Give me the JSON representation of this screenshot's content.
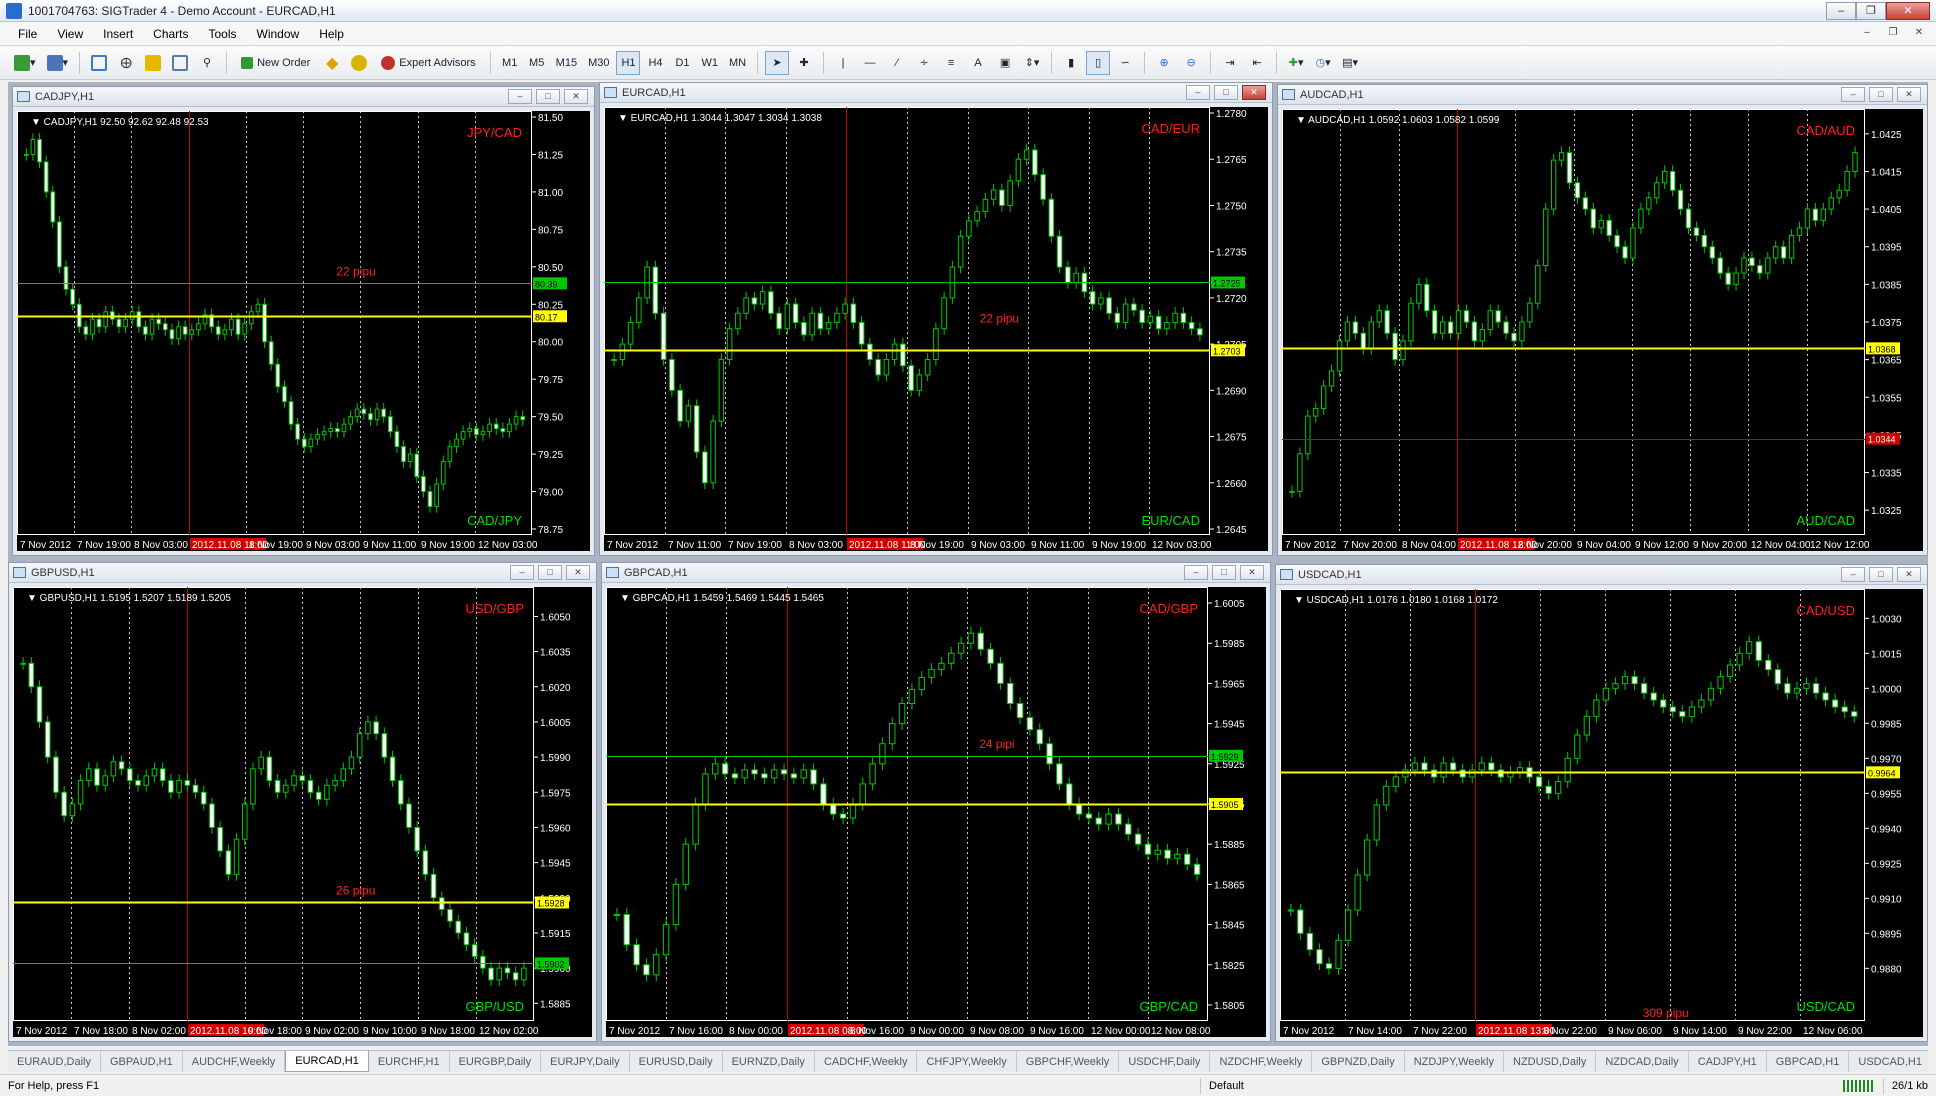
{
  "window": {
    "title": "1001704763: SIGTrader 4 - Demo Account - EURCAD,H1"
  },
  "menu": [
    "File",
    "View",
    "Insert",
    "Charts",
    "Tools",
    "Window",
    "Help"
  ],
  "toolbar": {
    "new_order": "New Order",
    "expert_advisors": "Expert Advisors",
    "timeframes": [
      "M1",
      "M5",
      "M15",
      "M30",
      "H1",
      "H4",
      "D1",
      "W1",
      "MN"
    ],
    "active_timeframe": "H1"
  },
  "charts": [
    {
      "window_title": "CADJPY,H1",
      "info": "CADJPY,H1  92.50 92.62 92.48 92.53",
      "label_top": "JPY/CAD",
      "label_bottom": "CAD/JPY",
      "pips_note": "22 pipu",
      "axis_min": 78.75,
      "axis_max": 81.5,
      "ticks": [
        "81.50",
        "81.25",
        "81.00",
        "80.75",
        "80.50",
        "80.25",
        "80.00",
        "79.75",
        "79.50",
        "79.25",
        "79.00",
        "78.75"
      ],
      "time_labels": [
        "7 Nov 2012",
        "7 Nov 19:00",
        "8 Nov 03:00",
        "",
        "8 Nov 19:00",
        "9 Nov 03:00",
        "9 Nov 11:00",
        "9 Nov 19:00",
        "12 Nov 03:00"
      ],
      "highlight_time": "2012.11.08 11:00",
      "levels": [
        {
          "value": 80.39,
          "label": "80.39",
          "color": "#00c800"
        },
        {
          "value": 80.17,
          "label": "80.17",
          "color": "#ffff00"
        }
      ],
      "closes": [
        81.25,
        81.35,
        81.2,
        81.0,
        80.8,
        80.5,
        80.35,
        80.25,
        80.1,
        80.05,
        80.15,
        80.1,
        80.2,
        80.15,
        80.1,
        80.15,
        80.2,
        80.1,
        80.05,
        80.15,
        80.12,
        80.08,
        80.02,
        80.1,
        80.05,
        80.08,
        80.12,
        80.18,
        80.1,
        80.05,
        80.08,
        80.15,
        80.05,
        80.12,
        80.2,
        80.25,
        80.0,
        79.85,
        79.7,
        79.6,
        79.45,
        79.35,
        79.3,
        79.35,
        79.38,
        79.4,
        79.42,
        79.4,
        79.45,
        79.5,
        79.55,
        79.52,
        79.48,
        79.55,
        79.5,
        79.4,
        79.3,
        79.2,
        79.25,
        79.1,
        79.0,
        78.9,
        79.05,
        79.2,
        79.3,
        79.35,
        79.4,
        79.42,
        79.38,
        79.4,
        79.45,
        79.42,
        79.4,
        79.45,
        79.5,
        79.48
      ]
    },
    {
      "window_title": "EURCAD,H1",
      "info": "EURCAD,H1  1.3044 1.3047 1.3034 1.3038",
      "label_top": "CAD/EUR",
      "label_bottom": "EUR/CAD",
      "pips_note": "22 pipu",
      "axis_min": 1.2645,
      "axis_max": 1.278,
      "ticks": [
        "1.2780",
        "1.2765",
        "1.2750",
        "1.2735",
        "1.2720",
        "1.2705",
        "1.2690",
        "1.2675",
        "1.2660",
        "1.2645"
      ],
      "time_labels": [
        "7 Nov 2012",
        "7 Nov 11:00",
        "7 Nov 19:00",
        "8 Nov 03:00",
        "",
        "8 Nov 19:00",
        "9 Nov 03:00",
        "9 Nov 11:00",
        "9 Nov 19:00",
        "12 Nov 03:00"
      ],
      "highlight_time": "2012.11.08 11:00",
      "levels": [
        {
          "value": 1.2725,
          "label": "1.2725",
          "color": "#00c800"
        },
        {
          "value": 1.2703,
          "label": "1.2703",
          "color": "#ffff00"
        }
      ],
      "closes": [
        1.27,
        1.2705,
        1.2712,
        1.272,
        1.273,
        1.2715,
        1.27,
        1.269,
        1.268,
        1.2685,
        1.267,
        1.266,
        1.268,
        1.27,
        1.271,
        1.2715,
        1.272,
        1.2718,
        1.2722,
        1.2715,
        1.271,
        1.2718,
        1.2712,
        1.2708,
        1.2715,
        1.271,
        1.2712,
        1.2715,
        1.2718,
        1.2712,
        1.2705,
        1.27,
        1.2695,
        1.27,
        1.2705,
        1.2698,
        1.269,
        1.2695,
        1.27,
        1.271,
        1.272,
        1.273,
        1.274,
        1.2745,
        1.2748,
        1.2752,
        1.2755,
        1.275,
        1.2758,
        1.2765,
        1.2768,
        1.276,
        1.2752,
        1.274,
        1.273,
        1.2725,
        1.2728,
        1.2722,
        1.2718,
        1.272,
        1.2715,
        1.2712,
        1.2718,
        1.2716,
        1.2712,
        1.2714,
        1.271,
        1.2712,
        1.2715,
        1.2712,
        1.271,
        1.2708
      ]
    },
    {
      "window_title": "AUDCAD,H1",
      "info": "AUDCAD,H1  1.0592 1.0603 1.0582 1.0599",
      "label_top": "CAD/AUD",
      "label_bottom": "AUD/CAD",
      "pips_note": "",
      "axis_min": 1.032,
      "axis_max": 1.043,
      "ticks": [
        "1.0425",
        "1.0415",
        "1.0405",
        "1.0395",
        "1.0385",
        "1.0375",
        "1.0365",
        "1.0355",
        "1.0345",
        "1.0335",
        "1.0325"
      ],
      "time_labels": [
        "7 Nov 2012",
        "7 Nov 20:00",
        "8 Nov 04:00",
        "",
        "8 Nov 20:00",
        "9 Nov 04:00",
        "9 Nov 12:00",
        "9 Nov 20:00",
        "12 Nov 04:00",
        "12 Nov 12:00"
      ],
      "highlight_time": "2012.11.08 12:00",
      "levels": [
        {
          "value": 1.0368,
          "label": "1.0368",
          "color": "#ffff00"
        },
        {
          "value": 1.0344,
          "label": "1.0344",
          "color": "#d00000"
        }
      ],
      "closes": [
        1.033,
        1.034,
        1.035,
        1.0352,
        1.0358,
        1.0362,
        1.037,
        1.0375,
        1.0372,
        1.0368,
        1.0375,
        1.0378,
        1.0372,
        1.0365,
        1.037,
        1.038,
        1.0385,
        1.0378,
        1.0372,
        1.0375,
        1.0372,
        1.0378,
        1.0375,
        1.037,
        1.0373,
        1.0378,
        1.0375,
        1.0372,
        1.037,
        1.0375,
        1.038,
        1.039,
        1.0405,
        1.0418,
        1.042,
        1.0412,
        1.0408,
        1.0405,
        1.04,
        1.0402,
        1.0398,
        1.0395,
        1.0392,
        1.04,
        1.0405,
        1.0408,
        1.0412,
        1.0415,
        1.041,
        1.0405,
        1.04,
        1.0398,
        1.0395,
        1.0392,
        1.0388,
        1.0385,
        1.0388,
        1.0392,
        1.039,
        1.0388,
        1.0392,
        1.0395,
        1.0392,
        1.0398,
        1.04,
        1.0405,
        1.0402,
        1.0405,
        1.0408,
        1.041,
        1.0415,
        1.042
      ]
    },
    {
      "window_title": "GBPUSD,H1",
      "info": "GBPUSD,H1  1.5195 1.5207 1.5189 1.5205",
      "label_top": "USD/GBP",
      "label_bottom": "GBP/USD",
      "pips_note": "26 pipu",
      "axis_min": 1.588,
      "axis_max": 1.606,
      "ticks": [
        "1.6050",
        "1.6035",
        "1.6020",
        "1.6005",
        "1.5990",
        "1.5975",
        "1.5960",
        "1.5945",
        "1.5930",
        "1.5915",
        "1.5900",
        "1.5885"
      ],
      "time_labels": [
        "7 Nov 2012",
        "7 Nov 18:00",
        "8 Nov 02:00",
        "",
        "9 Nov 18:00",
        "9 Nov 02:00",
        "9 Nov 10:00",
        "9 Nov 18:00",
        "12 Nov 02:00"
      ],
      "highlight_time": "2012.11.08 10:00",
      "levels": [
        {
          "value": 1.5928,
          "label": "1.5928",
          "color": "#ffff00"
        },
        {
          "value": 1.5902,
          "label": "1.5902",
          "color": "#00c800"
        }
      ],
      "closes": [
        1.603,
        1.602,
        1.6005,
        1.599,
        1.5975,
        1.5965,
        1.597,
        1.598,
        1.5985,
        1.5978,
        1.5982,
        1.5988,
        1.5985,
        1.598,
        1.5978,
        1.5982,
        1.5985,
        1.598,
        1.5975,
        1.598,
        1.5978,
        1.5975,
        1.597,
        1.596,
        1.595,
        1.594,
        1.5955,
        1.597,
        1.5985,
        1.599,
        1.598,
        1.5975,
        1.5978,
        1.5982,
        1.598,
        1.5975,
        1.5972,
        1.5978,
        1.598,
        1.5985,
        1.599,
        1.6,
        1.6005,
        1.6,
        1.599,
        1.598,
        1.597,
        1.596,
        1.595,
        1.594,
        1.593,
        1.5925,
        1.592,
        1.5915,
        1.591,
        1.5905,
        1.59,
        1.5895,
        1.59,
        1.5898,
        1.5895,
        1.59
      ]
    },
    {
      "window_title": "GBPCAD,H1",
      "info": "GBPCAD,H1  1.5459 1.5469 1.5445 1.5465",
      "label_top": "CAD/GBP",
      "label_bottom": "GBP/CAD",
      "pips_note": "24  pipi",
      "axis_min": 1.58,
      "axis_max": 1.601,
      "ticks": [
        "1.6005",
        "1.5985",
        "1.5965",
        "1.5945",
        "1.5925",
        "1.5905",
        "1.5885",
        "1.5865",
        "1.5845",
        "1.5825",
        "1.5805"
      ],
      "time_labels": [
        "7 Nov 2012",
        "7 Nov 16:00",
        "8 Nov 00:00",
        "",
        "8 Nov 16:00",
        "9 Nov 00:00",
        "9 Nov 08:00",
        "9 Nov 16:00",
        "12 Nov 00:00",
        "12 Nov 08:00"
      ],
      "highlight_time": "2012.11.08 08:00",
      "levels": [
        {
          "value": 1.5929,
          "label": "1.5929",
          "color": "#00c800"
        },
        {
          "value": 1.5905,
          "label": "1.5905",
          "color": "#ffff00"
        }
      ],
      "closes": [
        1.585,
        1.5835,
        1.5825,
        1.582,
        1.583,
        1.5845,
        1.5865,
        1.5885,
        1.5905,
        1.592,
        1.5925,
        1.592,
        1.5918,
        1.5922,
        1.592,
        1.5918,
        1.5922,
        1.592,
        1.5918,
        1.5922,
        1.5915,
        1.5905,
        1.59,
        1.5898,
        1.5905,
        1.5915,
        1.5925,
        1.5935,
        1.5945,
        1.5955,
        1.5962,
        1.5968,
        1.5972,
        1.5975,
        1.598,
        1.5985,
        1.599,
        1.5982,
        1.5975,
        1.5965,
        1.5955,
        1.5948,
        1.5942,
        1.5935,
        1.5925,
        1.5915,
        1.5905,
        1.59,
        1.5898,
        1.5895,
        1.59,
        1.5895,
        1.589,
        1.5885,
        1.588,
        1.5882,
        1.5878,
        1.588,
        1.5875,
        1.587
      ]
    },
    {
      "window_title": "USDCAD,H1",
      "info": "USDCAD,H1  1.0176 1.0180 1.0168 1.0172",
      "label_top": "CAD/USD",
      "label_bottom": "USD/CAD",
      "pips_note": "309 pipu",
      "axis_min": 0.986,
      "axis_max": 1.004,
      "ticks": [
        "1.0030",
        "1.0015",
        "1.0000",
        "0.9985",
        "0.9970",
        "0.9955",
        "0.9940",
        "0.9925",
        "0.9910",
        "0.9895",
        "0.9880"
      ],
      "time_labels": [
        "7 Nov 2012",
        "7 Nov 14:00",
        "7 Nov 22:00",
        "",
        "8 Nov 22:00",
        "9 Nov 06:00",
        "9 Nov 14:00",
        "9 Nov 22:00",
        "12 Nov 06:00"
      ],
      "highlight_time": "2012.11.08 13:00",
      "levels": [
        {
          "value": 0.9964,
          "label": "0.9964",
          "color": "#ffff00"
        }
      ],
      "closes": [
        0.9905,
        0.9895,
        0.9888,
        0.9882,
        0.988,
        0.9892,
        0.9905,
        0.992,
        0.9935,
        0.995,
        0.9958,
        0.9962,
        0.9965,
        0.9968,
        0.9965,
        0.9962,
        0.9968,
        0.9965,
        0.9962,
        0.9965,
        0.9968,
        0.9965,
        0.9962,
        0.9964,
        0.9966,
        0.9962,
        0.9958,
        0.9955,
        0.996,
        0.997,
        0.998,
        0.9988,
        0.9995,
        1.0,
        1.0002,
        1.0005,
        1.0002,
        0.9998,
        0.9995,
        0.9992,
        0.999,
        0.9988,
        0.9992,
        0.9995,
        1.0,
        1.0005,
        1.001,
        1.0015,
        1.002,
        1.0012,
        1.0008,
        1.0002,
        0.9998,
        1.0,
        1.0002,
        0.9998,
        0.9995,
        0.9992,
        0.999,
        0.9988
      ]
    }
  ],
  "tabs": [
    "EURAUD,Daily",
    "GBPAUD,H1",
    "AUDCHF,Weekly",
    "EURCAD,H1",
    "EURCHF,H1",
    "EURGBP,Daily",
    "EURJPY,Daily",
    "EURUSD,Daily",
    "EURNZD,Daily",
    "CADCHF,Weekly",
    "CHFJPY,Weekly",
    "GBPCHF,Weekly",
    "USDCHF,Daily",
    "NZDCHF,Weekly",
    "GBPNZD,Daily",
    "NZDJPY,Weekly",
    "NZDUSD,Daily",
    "NZDCAD,Daily",
    "CADJPY,H1",
    "GBPCAD,H1",
    "USDCAD,H1"
  ],
  "active_tab": "EURCAD,H1",
  "status": {
    "help": "For Help, press F1",
    "profile": "Default",
    "traffic": "26/1 kb"
  }
}
